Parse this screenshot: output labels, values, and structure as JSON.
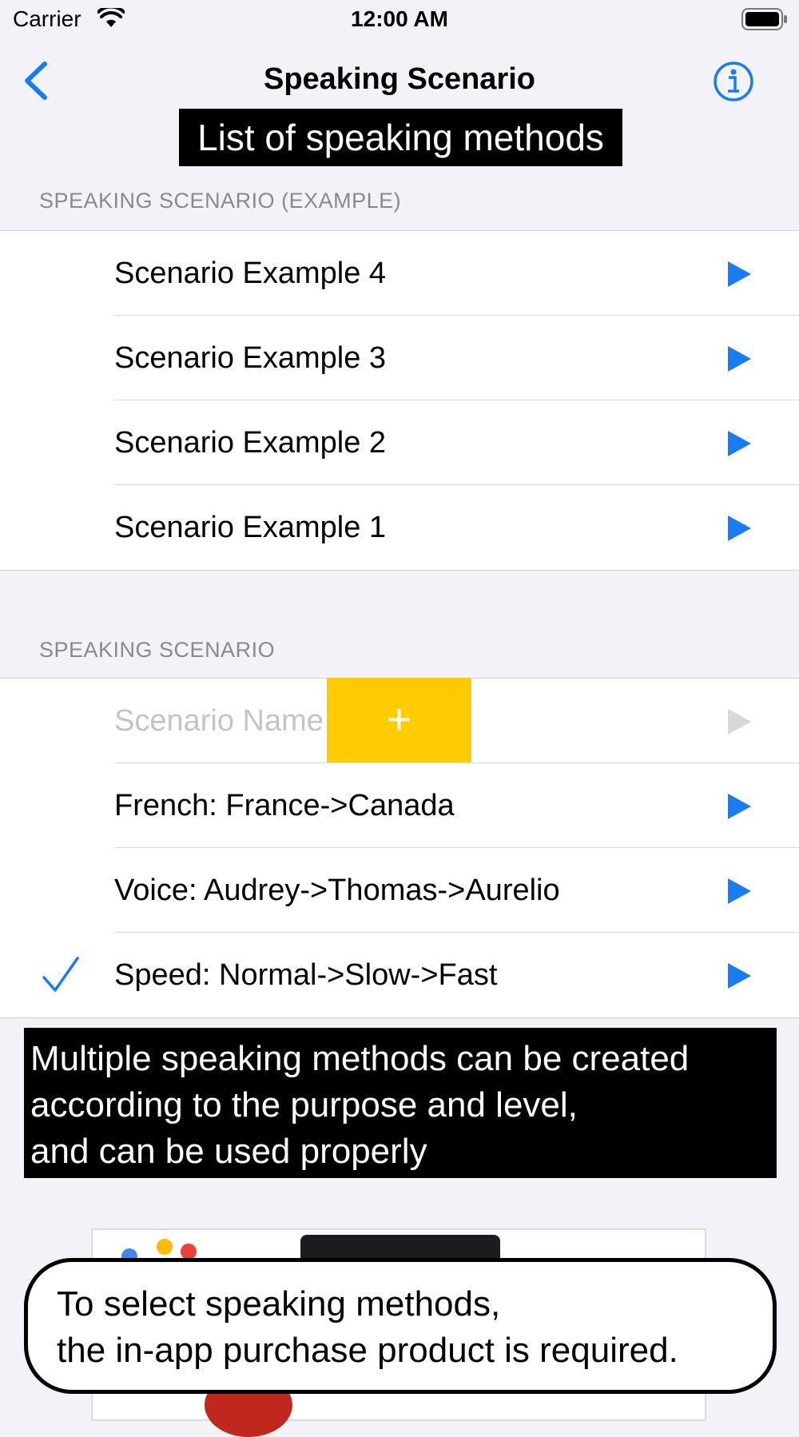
{
  "status_bar": {
    "carrier": "Carrier",
    "time": "12:00 AM"
  },
  "nav": {
    "title": "Speaking Scenario"
  },
  "caption_top": "List of speaking methods",
  "section_example": {
    "header": "SPEAKING SCENARIO (EXAMPLE)",
    "rows": [
      {
        "label": "Scenario Example 4"
      },
      {
        "label": "Scenario Example 3"
      },
      {
        "label": "Scenario Example 2"
      },
      {
        "label": "Scenario Example 1"
      }
    ]
  },
  "section_user": {
    "header": "SPEAKING SCENARIO",
    "name_placeholder": "Scenario Name",
    "add_symbol": "+",
    "rows": [
      {
        "label": "French: France->Canada"
      },
      {
        "label": "Voice: Audrey->Thomas->Aurelio"
      },
      {
        "label": "Speed: Normal->Slow->Fast"
      }
    ]
  },
  "caption_mid": {
    "lines": [
      "Multiple speaking methods can be created",
      "according to the purpose and level,",
      "and can be used properly"
    ]
  },
  "bubble": {
    "lines": [
      "To select speaking methods,",
      "the in-app purchase product is required."
    ]
  },
  "colors": {
    "accent": "#1a7cf5",
    "add_button": "#ffcc00",
    "background": "#f2f2f7"
  },
  "icons": {
    "back": "chevron-left-icon",
    "info": "info-circle-icon",
    "play": "play-icon",
    "check": "checkmark-icon"
  }
}
